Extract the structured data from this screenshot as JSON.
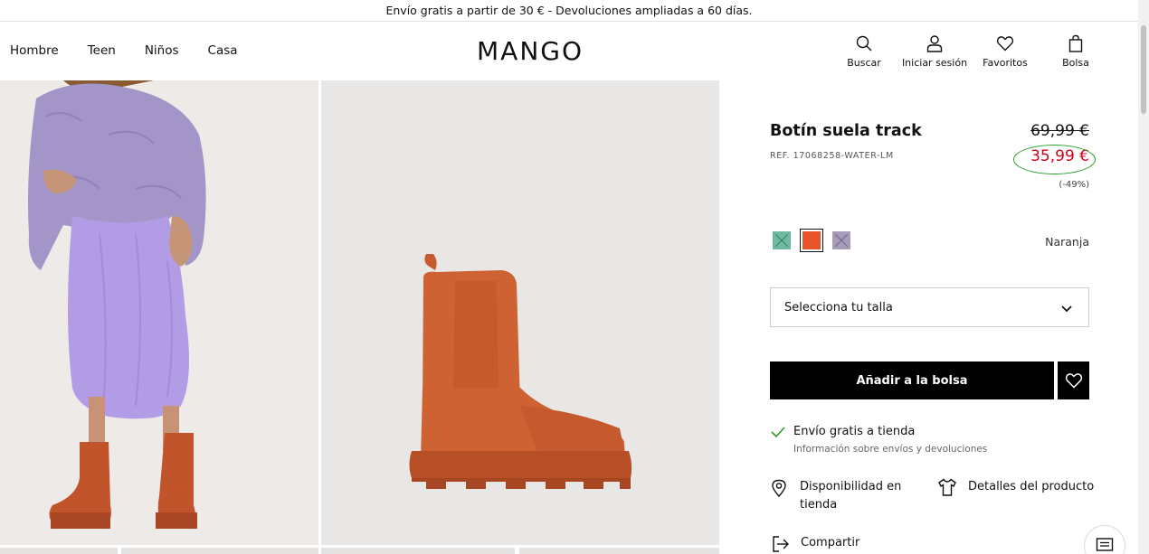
{
  "promo": {
    "text": "Envío gratis a partir de 30 € - Devoluciones ampliadas a 60 días."
  },
  "nav": {
    "items": [
      "Hombre",
      "Teen",
      "Niños",
      "Casa"
    ]
  },
  "brand": {
    "logo_text": "MANGO"
  },
  "actions": {
    "search": {
      "label": "Buscar",
      "icon": "search-icon"
    },
    "login": {
      "label": "Iniciar sesión",
      "icon": "user-icon"
    },
    "favorites": {
      "label": "Favoritos",
      "icon": "heart-icon"
    },
    "bag": {
      "label": "Bolsa",
      "icon": "bag-icon"
    }
  },
  "product": {
    "title": "Botín suela track",
    "ref": "REF. 17068258-WATER-LM",
    "old_price": "69,99 €",
    "new_price": "35,99 €",
    "discount": "(-49%)",
    "colors": [
      {
        "name": "teal",
        "hex": "#6fb9a3",
        "available": false
      },
      {
        "name": "Naranja",
        "hex": "#e8552a",
        "available": true,
        "selected": true
      },
      {
        "name": "lilac",
        "hex": "#a89db8",
        "available": false
      }
    ],
    "selected_color": "Naranja",
    "size_placeholder": "Selecciona tu talla",
    "add_to_bag": "Añadir a la bolsa"
  },
  "shipping": {
    "title": "Envío gratis a tienda",
    "subtitle": "Información sobre envíos y devoluciones"
  },
  "features": {
    "availability_line1": "Disponibilidad en",
    "availability_line2": "tienda",
    "details": "Detalles del producto",
    "share": "Compartir"
  },
  "colors": {
    "sale_red": "#d0021b",
    "highlight_green": "#2a9d2a",
    "black": "#000000"
  }
}
